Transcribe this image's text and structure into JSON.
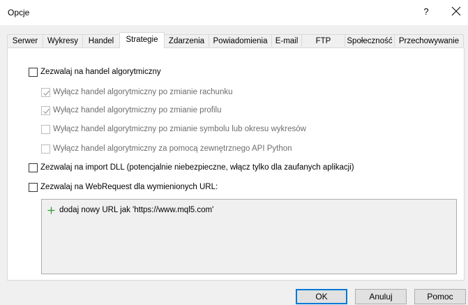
{
  "window": {
    "title": "Opcje",
    "help_label": "?",
    "close_icon": "close-icon"
  },
  "tabs": [
    {
      "label": "Serwer"
    },
    {
      "label": "Wykresy"
    },
    {
      "label": "Handel"
    },
    {
      "label": "Strategie",
      "active": true
    },
    {
      "label": "Zdarzenia"
    },
    {
      "label": "Powiadomienia"
    },
    {
      "label": "E-mail"
    },
    {
      "label": "FTP"
    },
    {
      "label": "Społeczność"
    },
    {
      "label": "Przechowywanie"
    }
  ],
  "options": {
    "algo_trading": {
      "label": "Zezwalaj na handel algorytmiczny",
      "checked": false
    },
    "disable_on_account": {
      "label": "Wyłącz handel algorytmiczny po zmianie rachunku",
      "checked": true,
      "disabled": true
    },
    "disable_on_profile": {
      "label": "Wyłącz handel algorytmiczny po zmianie profilu",
      "checked": true,
      "disabled": true
    },
    "disable_on_symbol": {
      "label": "Wyłącz handel algorytmiczny po zmianie symbolu lub okresu wykresów",
      "checked": false,
      "disabled": true
    },
    "disable_python": {
      "label": "Wyłącz handel algorytmiczny za pomocą zewnętrznego API Python",
      "checked": false,
      "disabled": true
    },
    "dll_import": {
      "label": "Zezwalaj na import DLL (potencjalnie niebezpieczne, włącz tylko dla zaufanych aplikacji)",
      "checked": false
    },
    "webrequest": {
      "label": "Zezwalaj na WebRequest dla wymienionych URL:",
      "checked": false
    }
  },
  "url_list": {
    "add_label": "dodaj nowy URL jak 'https://www.mql5.com'",
    "add_icon": "plus-icon",
    "accent": "#2e9c2e"
  },
  "buttons": {
    "ok": "OK",
    "cancel": "Anuluj",
    "help": "Pomoc"
  }
}
